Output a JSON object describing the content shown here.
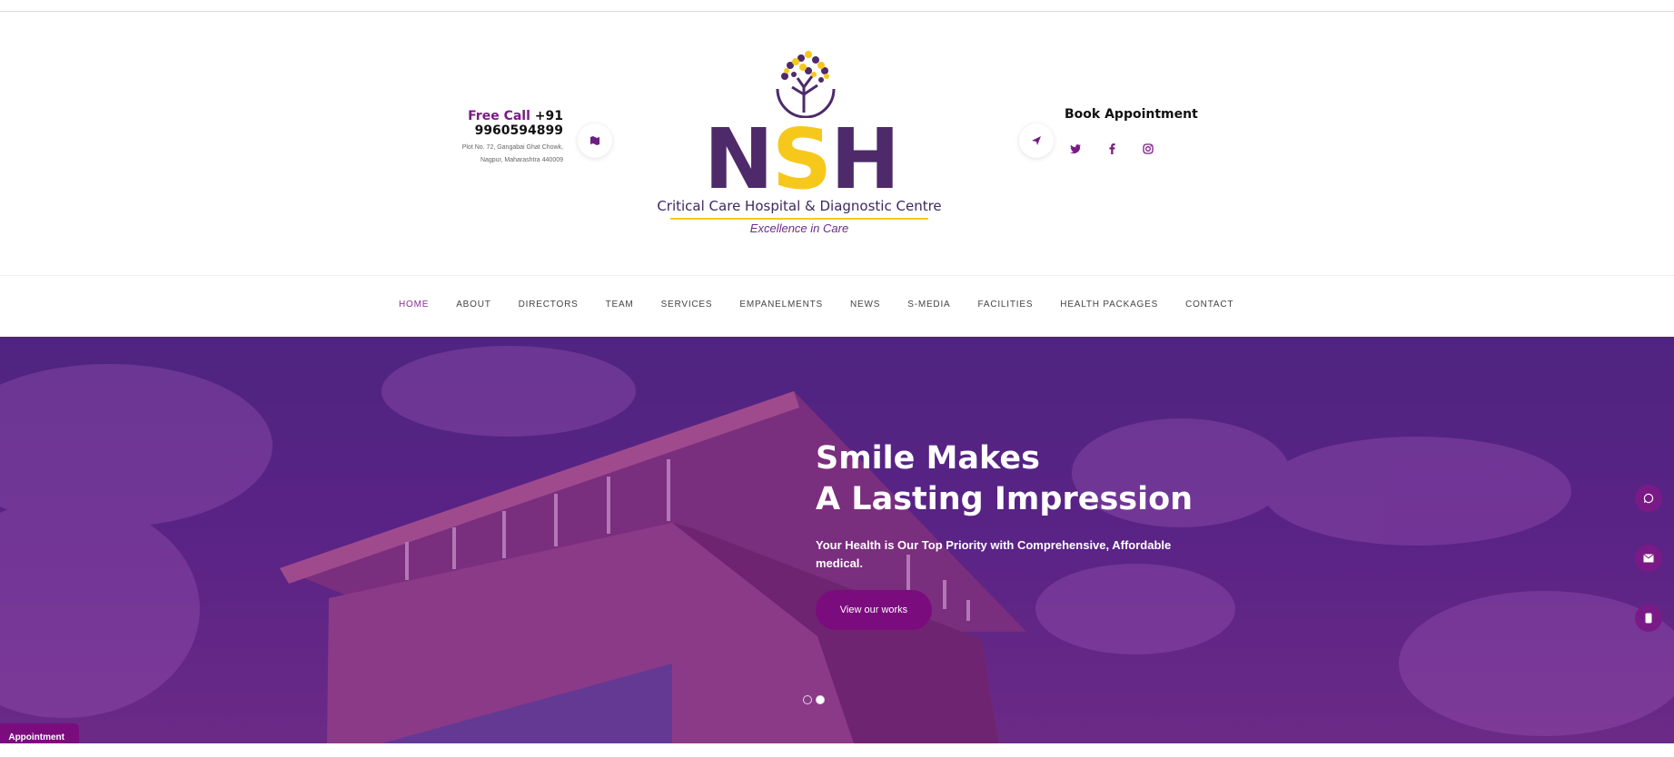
{
  "header": {
    "free_call_label": "Free Call",
    "phone": "+91 9960594899",
    "address_line1": "Plot No. 72, Gangabai Ghat Chowk,",
    "address_line2": "Nagpur, Maharashtra 440009",
    "book_appointment": "Book Appointment"
  },
  "logo": {
    "letters": [
      "N",
      "S",
      "H"
    ],
    "subtitle": "Critical Care Hospital & Diagnostic Centre",
    "tagline": "Excellence in Care"
  },
  "nav": {
    "items": [
      "HOME",
      "ABOUT",
      "DIRECTORS",
      "TEAM",
      "SERVICES",
      "EMPANELMENTS",
      "NEWS",
      "S-MEDIA",
      "FACILITIES",
      "HEALTH PACKAGES",
      "CONTACT"
    ],
    "active_index": 0
  },
  "hero": {
    "title_line1": "Smile Makes",
    "title_line2": "A Lasting Impression",
    "subtitle_line1": "Your Health is Our Top Priority with Comprehensive, Affordable",
    "subtitle_line2": "medical.",
    "button": "View our works",
    "slides_count": 2,
    "active_slide": 1
  },
  "side_icons": [
    "whatsapp-icon",
    "mail-icon",
    "phone-icon"
  ],
  "appointment_tab": "Appointment",
  "colors": {
    "brand_purple": "#7b0c7e",
    "logo_purple": "#4e2a6a",
    "logo_yellow": "#f7c81c",
    "nav_active": "#8a2b9c"
  }
}
